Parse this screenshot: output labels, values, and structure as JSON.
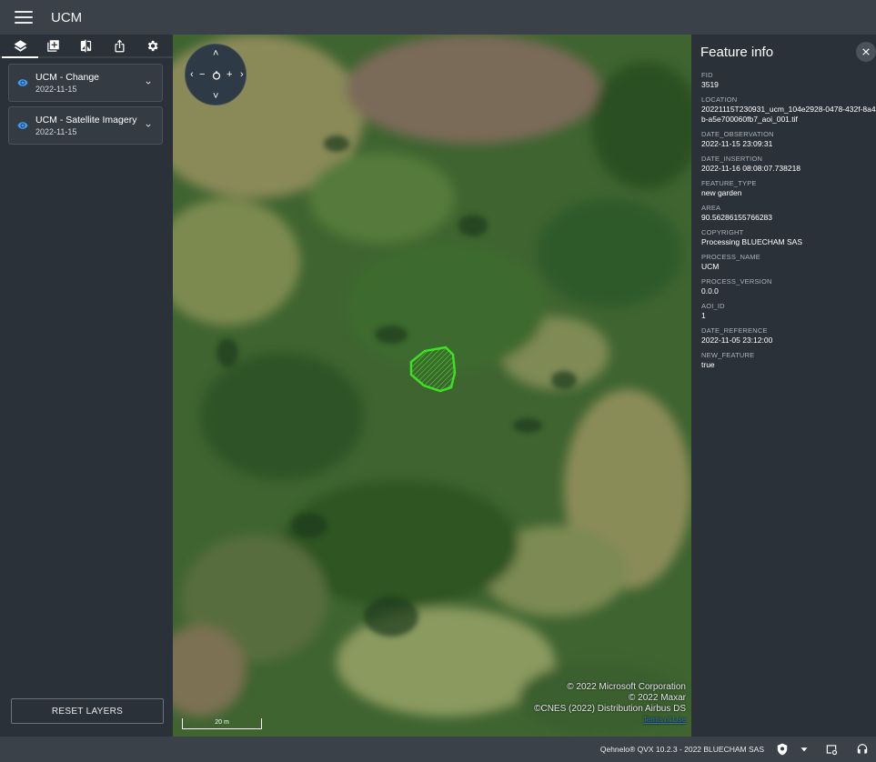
{
  "app": {
    "title": "UCM"
  },
  "left_toolbar": {
    "tools": [
      "layers-icon",
      "add-layer-icon",
      "compare-icon",
      "share-icon",
      "settings-icon"
    ]
  },
  "layers": [
    {
      "name": "UCM - Change",
      "date": "2022-11-15"
    },
    {
      "name": "UCM - Satellite Imagery",
      "date": "2022-11-15"
    }
  ],
  "reset_button": "RESET LAYERS",
  "map": {
    "scale_label": "20 m",
    "attribution": [
      "© 2022 Microsoft Corporation",
      "© 2022 Maxar",
      "©CNES (2022) Distribution Airbus DS"
    ],
    "terms_link": "Terms of Use",
    "highlight_color": "#3de024"
  },
  "feature_info": {
    "title": "Feature info",
    "fields": [
      {
        "key": "FID",
        "value": "3519"
      },
      {
        "key": "LOCATION",
        "value": "20221115T230931_ucm_104e2928-0478-432f-8a4b-a5e700060fb7_aoi_001.tif"
      },
      {
        "key": "DATE_OBSERVATION",
        "value": "2022-11-15 23:09:31"
      },
      {
        "key": "DATE_INSERTION",
        "value": "2022-11-16 08:08:07.738218"
      },
      {
        "key": "FEATURE_TYPE",
        "value": "new garden"
      },
      {
        "key": "AREA",
        "value": "90.56286155766283"
      },
      {
        "key": "COPYRIGHT",
        "value": "Processing BLUECHAM SAS"
      },
      {
        "key": "PROCESS_NAME",
        "value": "UCM"
      },
      {
        "key": "PROCESS_VERSION",
        "value": "0.0.0"
      },
      {
        "key": "AOI_ID",
        "value": "1"
      },
      {
        "key": "DATE_REFERENCE",
        "value": "2022-11-05 23:12:00"
      },
      {
        "key": "NEW_FEATURE",
        "value": "true"
      }
    ]
  },
  "footer": {
    "copyright": "Qehnelo® QVX 10.2.3 - 2022 BLUECHAM SAS"
  },
  "colors": {
    "accent": "#3aa0ff",
    "panel": "#2b3138",
    "bar": "#3a4149"
  }
}
